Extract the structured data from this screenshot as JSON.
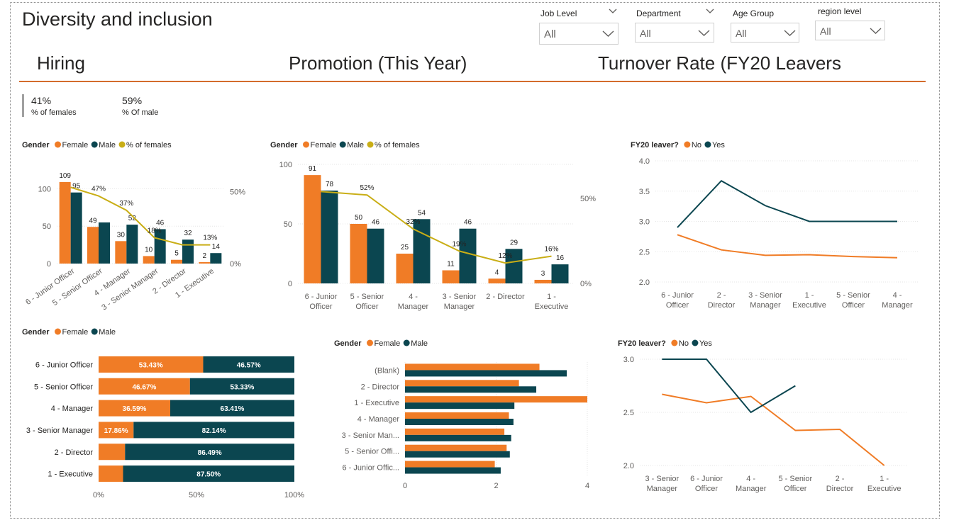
{
  "header": {
    "title": "Diversity and inclusion"
  },
  "slicers": [
    {
      "label": "Job Level",
      "value": "All"
    },
    {
      "label": "Department",
      "value": "All"
    },
    {
      "label": "Age Group",
      "value": "All"
    },
    {
      "label": "region level",
      "value": "All"
    }
  ],
  "sections": {
    "hiring": "Hiring",
    "promotion": "Promotion (This Year)",
    "turnover": "Turnover Rate (FY20 Leavers"
  },
  "kpis": [
    {
      "value": "41%",
      "label": "% of females"
    },
    {
      "value": "59%",
      "label": "% Of male"
    }
  ],
  "colors": {
    "female": "#f07c26",
    "male": "#0b4650",
    "pct": "#c9ae16",
    "accent": "#d36b2b",
    "axis": "#605e5c",
    "grid": "#e6e6e6"
  },
  "chart_data": [
    {
      "id": "hiring",
      "type": "bar",
      "legend_title": "Gender",
      "legend": [
        "Female",
        "Male",
        "% of females"
      ],
      "categories": [
        "6 - Junior Officer",
        "5 - Senior Officer",
        "4 - Manager",
        "3 - Senior Manager",
        "2 - Director",
        "1 - Executive"
      ],
      "series": [
        {
          "name": "Female",
          "values": [
            109,
            49,
            30,
            10,
            5,
            2
          ]
        },
        {
          "name": "Male",
          "values": [
            95,
            55,
            52,
            46,
            32,
            14
          ]
        },
        {
          "name": "% of females",
          "values": [
            53,
            47,
            37,
            18,
            13,
            13
          ],
          "labels": [
            "",
            "47%",
            "37%",
            "18%",
            "",
            "13%"
          ]
        }
      ],
      "count_labels": {
        "Female": [
          "109",
          "49",
          "30",
          "10",
          "5",
          "2"
        ],
        "Male": [
          "95",
          "",
          "52",
          "46",
          "32",
          "14"
        ]
      },
      "y_ticks": [
        "0",
        "50",
        "100"
      ],
      "y2_ticks": [
        "0%",
        "50%"
      ],
      "ylim": [
        0,
        125
      ],
      "y2lim": [
        0,
        65
      ]
    },
    {
      "id": "promotion",
      "type": "bar",
      "legend_title": "Gender",
      "legend": [
        "Female",
        "Male",
        "% of females"
      ],
      "categories": [
        "6 - Junior Officer",
        "5 - Senior Officer",
        "4 - Manager",
        "3 - Senior Manager",
        "2 - Director",
        "1 - Executive"
      ],
      "category_lines": [
        [
          "6 - Junior",
          "Officer"
        ],
        [
          "5 - Senior",
          "Officer"
        ],
        [
          "4 -",
          "Manager"
        ],
        [
          "3 - Senior",
          "Manager"
        ],
        [
          "2 - Director"
        ],
        [
          "1 -",
          "Executive"
        ]
      ],
      "series": [
        {
          "name": "Female",
          "values": [
            91,
            50,
            25,
            11,
            4,
            3
          ]
        },
        {
          "name": "Male",
          "values": [
            78,
            46,
            54,
            46,
            29,
            16
          ]
        },
        {
          "name": "% of females",
          "values": [
            54,
            52,
            32,
            19,
            12,
            16
          ],
          "labels": [
            "",
            "52%",
            "32%",
            "19%",
            "12%",
            "16%"
          ]
        }
      ],
      "count_labels": {
        "Female": [
          "91",
          "50",
          "25",
          "11",
          "4",
          "3"
        ],
        "Male": [
          "78",
          "46",
          "54",
          "46",
          "29",
          "16"
        ]
      },
      "y_ticks": [
        "0",
        "50",
        "100"
      ],
      "y2_ticks": [
        "0%",
        "50%"
      ],
      "ylim": [
        0,
        100
      ],
      "y2lim": [
        0,
        70
      ]
    },
    {
      "id": "turnover_line_1",
      "type": "line",
      "legend_title": "FY20 leaver?",
      "legend": [
        "No",
        "Yes"
      ],
      "categories": [
        "6 - Junior Officer",
        "2 - Director",
        "3 - Senior Manager",
        "1 - Executive",
        "5 - Senior Officer",
        "4 - Manager"
      ],
      "category_lines": [
        [
          "6 - Junior",
          "Officer"
        ],
        [
          "2 -",
          "Director"
        ],
        [
          "3 - Senior",
          "Manager"
        ],
        [
          "1 -",
          "Executive"
        ],
        [
          "5 - Senior",
          "Officer"
        ],
        [
          "4 -",
          "Manager"
        ]
      ],
      "series": [
        {
          "name": "No",
          "values": [
            2.78,
            2.53,
            2.44,
            2.45,
            2.42,
            2.4
          ]
        },
        {
          "name": "Yes",
          "values": [
            2.9,
            3.67,
            3.26,
            3.0,
            3.0,
            3.0
          ]
        }
      ],
      "y_ticks": [
        "2.0",
        "2.5",
        "3.0",
        "3.5",
        "4.0"
      ],
      "ylim": [
        2.0,
        4.0
      ]
    },
    {
      "id": "hiring_share",
      "type": "bar",
      "orientation": "horizontal-stacked-100",
      "legend_title": "Gender",
      "legend": [
        "Female",
        "Male"
      ],
      "categories": [
        "6 - Junior Officer",
        "5 - Senior Officer",
        "4 - Manager",
        "3 - Senior Manager",
        "2 - Director",
        "1 - Executive"
      ],
      "series": [
        {
          "name": "Female",
          "values": [
            53.43,
            46.67,
            36.59,
            17.86,
            13.51,
            12.5
          ],
          "labels": [
            "53.43%",
            "46.67%",
            "36.59%",
            "17.86%",
            "",
            ""
          ]
        },
        {
          "name": "Male",
          "values": [
            46.57,
            53.33,
            63.41,
            82.14,
            86.49,
            87.5
          ],
          "labels": [
            "46.57%",
            "53.33%",
            "63.41%",
            "82.14%",
            "86.49%",
            "87.50%"
          ]
        }
      ],
      "x_ticks": [
        "0%",
        "50%",
        "100%"
      ]
    },
    {
      "id": "promotion_bars",
      "type": "bar",
      "orientation": "horizontal",
      "legend_title": "Gender",
      "legend": [
        "Female",
        "Male"
      ],
      "categories": [
        "(Blank)",
        "2 - Director",
        "1 - Executive",
        "4 - Manager",
        "3 - Senior Man...",
        "5 - Senior Offi...",
        "6 - Junior Offic..."
      ],
      "series": [
        {
          "name": "Female",
          "values": [
            2.95,
            2.5,
            4.0,
            2.28,
            2.18,
            2.23,
            1.97
          ]
        },
        {
          "name": "Male",
          "values": [
            3.55,
            2.88,
            2.4,
            2.38,
            2.33,
            2.3,
            2.1
          ]
        }
      ],
      "x_ticks": [
        "0",
        "2",
        "4"
      ],
      "xlim": [
        0,
        4
      ]
    },
    {
      "id": "turnover_line_2",
      "type": "line",
      "legend_title": "FY20 leaver?",
      "legend": [
        "No",
        "Yes"
      ],
      "categories": [
        "3 - Senior Manager",
        "6 - Junior Officer",
        "4 - Manager",
        "5 - Senior Officer",
        "2 - Director",
        "1 - Executive"
      ],
      "category_lines": [
        [
          "3 - Senior",
          "Manager"
        ],
        [
          "6 - Junior",
          "Officer"
        ],
        [
          "4 -",
          "Manager"
        ],
        [
          "5 - Senior",
          "Officer"
        ],
        [
          "2 -",
          "Director"
        ],
        [
          "1 -",
          "Executive"
        ]
      ],
      "series": [
        {
          "name": "No",
          "values": [
            2.67,
            2.59,
            2.65,
            2.33,
            2.34,
            2.0
          ]
        },
        {
          "name": "Yes",
          "values": [
            3.0,
            3.0,
            2.5,
            2.75,
            null,
            null
          ]
        }
      ],
      "y_ticks": [
        "2.0",
        "2.5",
        "3.0"
      ],
      "ylim": [
        2.0,
        3.0
      ]
    }
  ]
}
